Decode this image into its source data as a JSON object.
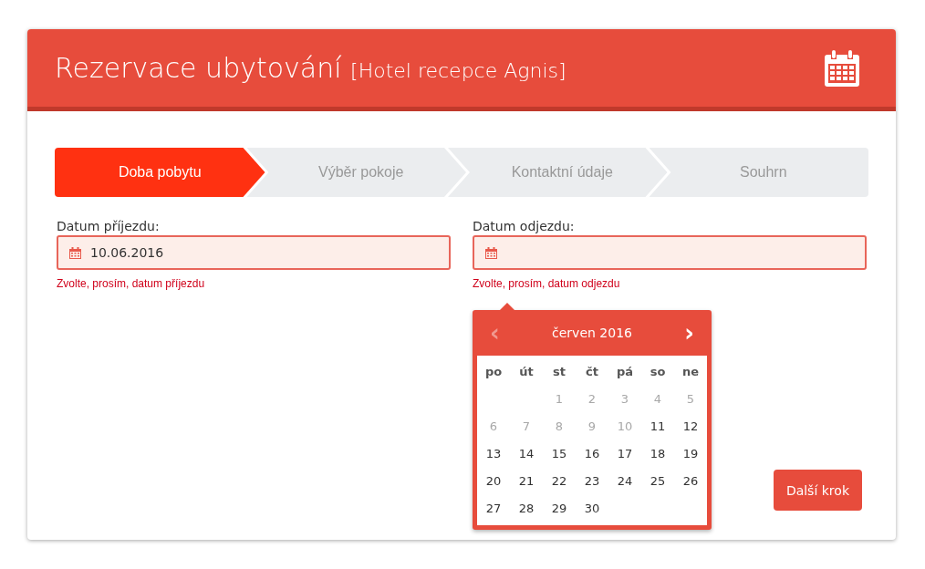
{
  "header": {
    "title": "Rezervace ubytování",
    "subtitle": "[Hotel recepce Agnis]"
  },
  "steps": [
    {
      "label": "Doba pobytu",
      "selected": true
    },
    {
      "label": "Výběr pokoje",
      "selected": false
    },
    {
      "label": "Kontaktní údaje",
      "selected": false
    },
    {
      "label": "Souhrn",
      "selected": false
    }
  ],
  "fields": [
    {
      "label": "Datum příjezdu:",
      "value": "10.06.2016",
      "error": "Zvolte, prosím, datum příjezdu"
    },
    {
      "label": "Datum odjezdu:",
      "error": "Zvolte, prosím, datum odjezdu"
    }
  ],
  "datepicker": {
    "month": "červen 2016",
    "prev": {
      "label": "‹",
      "disabled": true
    },
    "next": {
      "label": "›",
      "disabled": false
    },
    "weekdays": [
      "po",
      "út",
      "st",
      "čt",
      "pá",
      "so",
      "ne"
    ],
    "weeks": [
      {
        "days": [
          {
            "label": "1",
            "disabled": true
          },
          {
            "label": "2",
            "disabled": true
          },
          {
            "label": "3",
            "disabled": true
          },
          {
            "label": "4",
            "disabled": true
          },
          {
            "label": "5",
            "disabled": true
          }
        ]
      },
      {
        "days": [
          {
            "label": "6",
            "disabled": true
          },
          {
            "label": "7",
            "disabled": true
          },
          {
            "label": "8",
            "disabled": true
          },
          {
            "label": "9",
            "disabled": true
          },
          {
            "label": "10",
            "disabled": true
          },
          {
            "label": "11",
            "disabled": false
          },
          {
            "label": "12",
            "disabled": false
          }
        ]
      },
      {
        "days": [
          {
            "label": "13",
            "disabled": false
          },
          {
            "label": "14",
            "disabled": false
          },
          {
            "label": "15",
            "disabled": false
          },
          {
            "label": "16",
            "disabled": false
          },
          {
            "label": "17",
            "disabled": false
          },
          {
            "label": "18",
            "disabled": false
          },
          {
            "label": "19",
            "disabled": false
          }
        ]
      },
      {
        "days": [
          {
            "label": "20",
            "disabled": false
          },
          {
            "label": "21",
            "disabled": false
          },
          {
            "label": "22",
            "disabled": false
          },
          {
            "label": "23",
            "disabled": false
          },
          {
            "label": "24",
            "disabled": false
          },
          {
            "label": "25",
            "disabled": false
          },
          {
            "label": "26",
            "disabled": false
          }
        ]
      },
      {
        "days": [
          {
            "label": "27",
            "disabled": false
          },
          {
            "label": "28",
            "disabled": false
          },
          {
            "label": "29",
            "disabled": false
          },
          {
            "label": "30",
            "disabled": false
          }
        ]
      }
    ]
  },
  "next_button": "Další krok"
}
